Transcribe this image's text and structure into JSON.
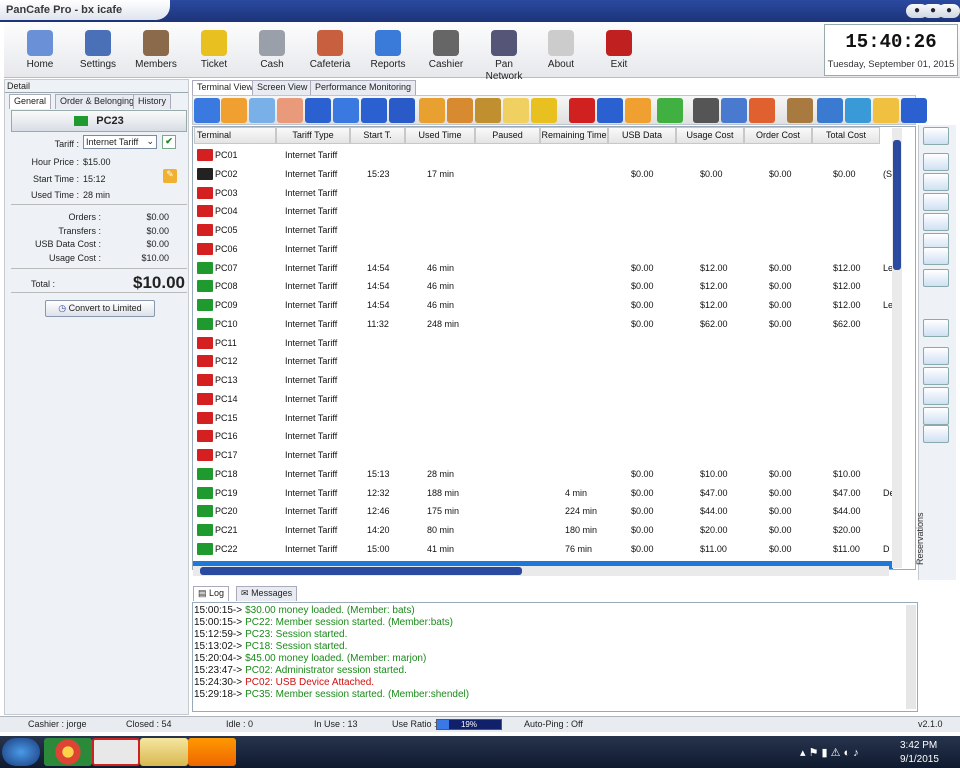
{
  "window": {
    "title": "PanCafe Pro - bx icafe"
  },
  "toolbar": {
    "items": [
      {
        "label": "Home",
        "icon": "home-icon"
      },
      {
        "label": "Settings",
        "icon": "settings-icon"
      },
      {
        "label": "Members",
        "icon": "members-icon"
      },
      {
        "label": "Ticket",
        "icon": "ticket-icon"
      },
      {
        "label": "Cash",
        "icon": "cash-icon"
      },
      {
        "label": "Cafeteria",
        "icon": "cafeteria-icon"
      },
      {
        "label": "Reports",
        "icon": "reports-icon"
      },
      {
        "label": "Cashier",
        "icon": "cashier-icon"
      },
      {
        "label": "Pan Network",
        "icon": "globe-icon"
      },
      {
        "label": "About",
        "icon": "info-icon"
      },
      {
        "label": "Exit",
        "icon": "exit-icon"
      }
    ]
  },
  "clock": {
    "time": "15:40:26",
    "date": "Tuesday, September 01, 2015"
  },
  "detail": {
    "header": "Detail",
    "tabs": [
      "General",
      "Order & Belonging",
      "History"
    ],
    "pc": "PC23",
    "tariff_label": "Tariff :",
    "tariff_value": "Internet Tariff",
    "hour_price_label": "Hour Price :",
    "hour_price": "$15.00",
    "start_time_label": "Start Time :",
    "start_time": "15:12",
    "used_time_label": "Used Time :",
    "used_time": "28 min",
    "orders_label": "Orders :",
    "orders": "$0.00",
    "transfers_label": "Transfers :",
    "transfers": "$0.00",
    "usb_label": "USB Data Cost :",
    "usb": "$0.00",
    "usage_label": "Usage Cost :",
    "usage": "$10.00",
    "total_label": "Total :",
    "total": "$10.00",
    "convert_button": "Convert to Limited"
  },
  "view_tabs": [
    "Terminal View",
    "Screen View",
    "Performance Monitoring"
  ],
  "grid": {
    "columns": [
      "Terminal",
      "Tariff Type",
      "Start T.",
      "Used Time",
      "Paused",
      "Remaining Time",
      "USB Data",
      "Usage Cost",
      "Order Cost",
      "Total Cost"
    ],
    "rows": [
      {
        "terminal": "PC01",
        "tariff": "Internet Tariff",
        "start": "",
        "used": "",
        "paused": "",
        "remaining": "",
        "usb": "",
        "usage": "",
        "order": "",
        "total": "",
        "extra": "",
        "status": "off"
      },
      {
        "terminal": "PC02",
        "tariff": "Internet Tariff",
        "start": "15:23",
        "used": "17 min",
        "paused": "",
        "remaining": "",
        "usb": "$0.00",
        "usage": "$0.00",
        "order": "$0.00",
        "total": "$0.00",
        "extra": "(S",
        "status": "admin"
      },
      {
        "terminal": "PC03",
        "tariff": "Internet Tariff",
        "start": "",
        "used": "",
        "paused": "",
        "remaining": "",
        "usb": "",
        "usage": "",
        "order": "",
        "total": "",
        "extra": "",
        "status": "off"
      },
      {
        "terminal": "PC04",
        "tariff": "Internet Tariff",
        "start": "",
        "used": "",
        "paused": "",
        "remaining": "",
        "usb": "",
        "usage": "",
        "order": "",
        "total": "",
        "extra": "",
        "status": "off"
      },
      {
        "terminal": "PC05",
        "tariff": "Internet Tariff",
        "start": "",
        "used": "",
        "paused": "",
        "remaining": "",
        "usb": "",
        "usage": "",
        "order": "",
        "total": "",
        "extra": "",
        "status": "off"
      },
      {
        "terminal": "PC06",
        "tariff": "Internet Tariff",
        "start": "",
        "used": "",
        "paused": "",
        "remaining": "",
        "usb": "",
        "usage": "",
        "order": "",
        "total": "",
        "extra": "",
        "status": "off"
      },
      {
        "terminal": "PC07",
        "tariff": "Internet Tariff",
        "start": "14:54",
        "used": "46 min",
        "paused": "",
        "remaining": "",
        "usb": "$0.00",
        "usage": "$12.00",
        "order": "$0.00",
        "total": "$12.00",
        "extra": "Le",
        "status": "on"
      },
      {
        "terminal": "PC08",
        "tariff": "Internet Tariff",
        "start": "14:54",
        "used": "46 min",
        "paused": "",
        "remaining": "",
        "usb": "$0.00",
        "usage": "$12.00",
        "order": "$0.00",
        "total": "$12.00",
        "extra": "",
        "status": "on"
      },
      {
        "terminal": "PC09",
        "tariff": "Internet Tariff",
        "start": "14:54",
        "used": "46 min",
        "paused": "",
        "remaining": "",
        "usb": "$0.00",
        "usage": "$12.00",
        "order": "$0.00",
        "total": "$12.00",
        "extra": "Le",
        "status": "on"
      },
      {
        "terminal": "PC10",
        "tariff": "Internet Tariff",
        "start": "11:32",
        "used": "248 min",
        "paused": "",
        "remaining": "",
        "usb": "$0.00",
        "usage": "$62.00",
        "order": "$0.00",
        "total": "$62.00",
        "extra": "",
        "status": "on"
      },
      {
        "terminal": "PC11",
        "tariff": "Internet Tariff",
        "start": "",
        "used": "",
        "paused": "",
        "remaining": "",
        "usb": "",
        "usage": "",
        "order": "",
        "total": "",
        "extra": "",
        "status": "off"
      },
      {
        "terminal": "PC12",
        "tariff": "Internet Tariff",
        "start": "",
        "used": "",
        "paused": "",
        "remaining": "",
        "usb": "",
        "usage": "",
        "order": "",
        "total": "",
        "extra": "",
        "status": "off"
      },
      {
        "terminal": "PC13",
        "tariff": "Internet Tariff",
        "start": "",
        "used": "",
        "paused": "",
        "remaining": "",
        "usb": "",
        "usage": "",
        "order": "",
        "total": "",
        "extra": "",
        "status": "off"
      },
      {
        "terminal": "PC14",
        "tariff": "Internet Tariff",
        "start": "",
        "used": "",
        "paused": "",
        "remaining": "",
        "usb": "",
        "usage": "",
        "order": "",
        "total": "",
        "extra": "",
        "status": "off"
      },
      {
        "terminal": "PC15",
        "tariff": "Internet Tariff",
        "start": "",
        "used": "",
        "paused": "",
        "remaining": "",
        "usb": "",
        "usage": "",
        "order": "",
        "total": "",
        "extra": "",
        "status": "off"
      },
      {
        "terminal": "PC16",
        "tariff": "Internet Tariff",
        "start": "",
        "used": "",
        "paused": "",
        "remaining": "",
        "usb": "",
        "usage": "",
        "order": "",
        "total": "",
        "extra": "",
        "status": "off"
      },
      {
        "terminal": "PC17",
        "tariff": "Internet Tariff",
        "start": "",
        "used": "",
        "paused": "",
        "remaining": "",
        "usb": "",
        "usage": "",
        "order": "",
        "total": "",
        "extra": "",
        "status": "off"
      },
      {
        "terminal": "PC18",
        "tariff": "Internet Tariff",
        "start": "15:13",
        "used": "28 min",
        "paused": "",
        "remaining": "",
        "usb": "$0.00",
        "usage": "$10.00",
        "order": "$0.00",
        "total": "$10.00",
        "extra": "",
        "status": "on"
      },
      {
        "terminal": "PC19",
        "tariff": "Internet Tariff",
        "start": "12:32",
        "used": "188 min",
        "paused": "",
        "remaining": "4 min",
        "usb": "$0.00",
        "usage": "$47.00",
        "order": "$0.00",
        "total": "$47.00",
        "extra": "De",
        "status": "member"
      },
      {
        "terminal": "PC20",
        "tariff": "Internet Tariff",
        "start": "12:46",
        "used": "175 min",
        "paused": "",
        "remaining": "224 min",
        "usb": "$0.00",
        "usage": "$44.00",
        "order": "$0.00",
        "total": "$44.00",
        "extra": "",
        "status": "member"
      },
      {
        "terminal": "PC21",
        "tariff": "Internet Tariff",
        "start": "14:20",
        "used": "80 min",
        "paused": "",
        "remaining": "180 min",
        "usb": "$0.00",
        "usage": "$20.00",
        "order": "$0.00",
        "total": "$20.00",
        "extra": "",
        "status": "member"
      },
      {
        "terminal": "PC22",
        "tariff": "Internet Tariff",
        "start": "15:00",
        "used": "41 min",
        "paused": "",
        "remaining": "76 min",
        "usb": "$0.00",
        "usage": "$11.00",
        "order": "$0.00",
        "total": "$11.00",
        "extra": "D",
        "status": "member"
      }
    ]
  },
  "reservations_label": "Reservations",
  "log": {
    "tabs": [
      "Log",
      "Messages"
    ],
    "lines": [
      {
        "time": "15:00:15->",
        "text": "$30.00 money loaded. (Member: bats)",
        "color": "#1a8a1a"
      },
      {
        "time": "15:00:15->",
        "text": "PC22: Member session started. (Member:bats)",
        "color": "#1a8a1a"
      },
      {
        "time": "15:12:59->",
        "text": "PC23: Session started.",
        "color": "#1a8a1a"
      },
      {
        "time": "15:13:02->",
        "text": "PC18: Session started.",
        "color": "#1a8a1a"
      },
      {
        "time": "15:20:04->",
        "text": "$45.00 money loaded. (Member: marjon)",
        "color": "#1a8a1a"
      },
      {
        "time": "15:23:47->",
        "text": "PC02: Administrator session started.",
        "color": "#1a8a1a"
      },
      {
        "time": "15:24:30->",
        "text": "PC02: USB Device Attached.",
        "color": "#d01010"
      },
      {
        "time": "15:29:18->",
        "text": "PC35: Member session started. (Member:shendel)",
        "color": "#1a8a1a"
      }
    ]
  },
  "status": {
    "cashier": "Cashier : jorge",
    "closed": "Closed : 54",
    "idle": "Idle : 0",
    "inuse": "In Use : 13",
    "ratio_label": "Use Ratio :",
    "ratio": "19%",
    "ratio_value": 0.19,
    "autoping": "Auto-Ping : Off",
    "version": "v2.1.0"
  },
  "taskbar": {
    "time": "3:42 PM",
    "date": "9/1/2015"
  },
  "colors": {
    "accent": "#2a4aa0",
    "selected_row": "#1e78d8",
    "monitor_off": "#d42020",
    "monitor_on": "#1e9a2e"
  }
}
